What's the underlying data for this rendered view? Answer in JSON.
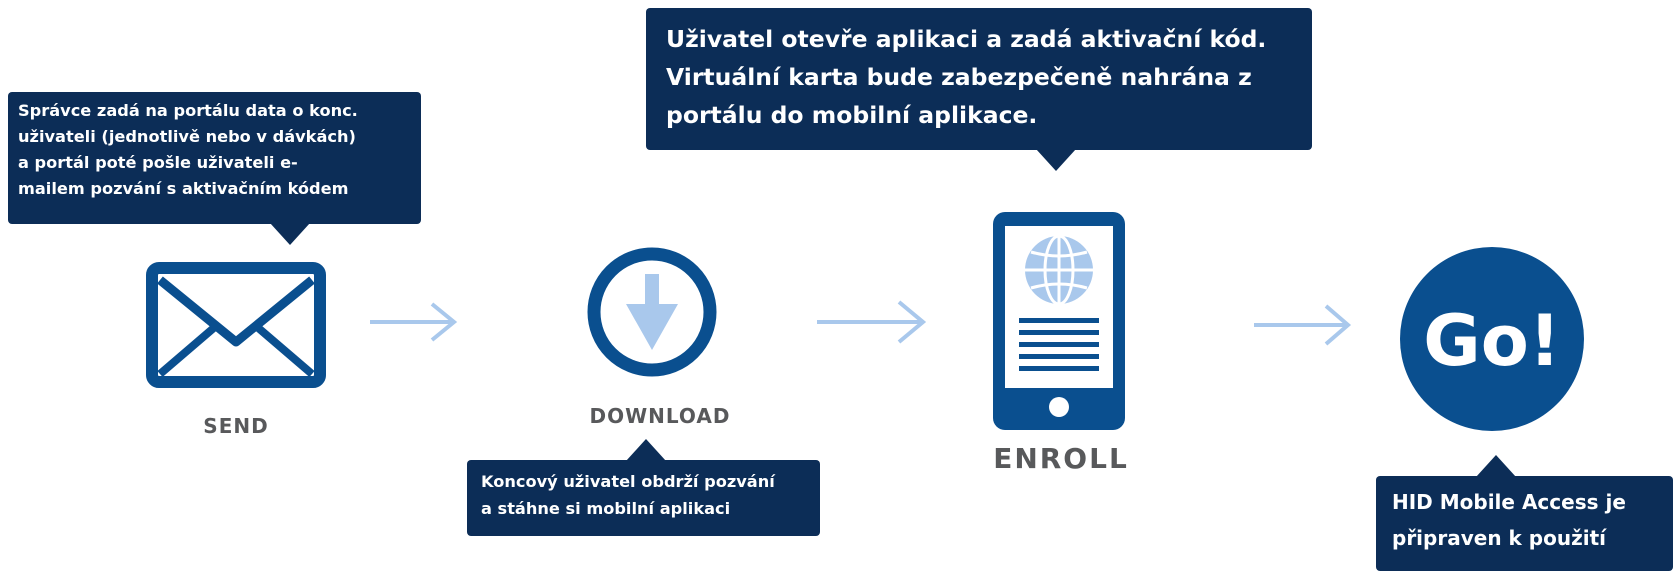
{
  "steps": [
    {
      "id": "send",
      "label": "SEND",
      "icon": "envelope-icon"
    },
    {
      "id": "download",
      "label": "DOWNLOAD",
      "icon": "download-icon"
    },
    {
      "id": "enroll",
      "label": "ENROLL",
      "icon": "mobile-phone-icon"
    },
    {
      "id": "go",
      "label": "Go!",
      "icon": "go-circle-icon"
    }
  ],
  "callouts": {
    "send": "Správce zadá na portálu data o konc.\nuživateli (jednotlivě nebo v dávkách)\na portál poté pošle uživateli e-\nmailem pozvání s aktivačním kódem",
    "enroll": "Uživatel otevře aplikaci a zadá aktivační kód.\nVirtuální karta bude zabezpečeně nahrána  z\nportálu do mobilní aplikace.",
    "download": "Koncový uživatel obdrží pozvání\na stáhne si mobilní aplikaci",
    "go": "HID Mobile Access je\npřipraven k použití"
  },
  "colors": {
    "primary_blue": "#0a4f8f",
    "callout_navy": "#0c2d57",
    "light_blue": "#a9c8ec",
    "label_gray": "#58595b"
  }
}
